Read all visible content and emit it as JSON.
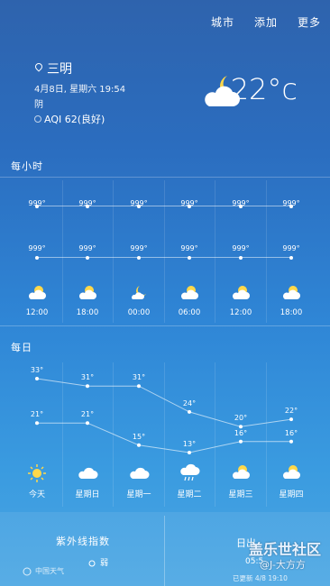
{
  "menu": {
    "city": "城市",
    "add": "添加",
    "more": "更多"
  },
  "current": {
    "city": "三明",
    "datetime": "4月8日, 星期六 19:54",
    "condition": "阴",
    "aqi": "AQI 62(良好)",
    "temperature": "22°c",
    "icon": "moon-cloud-icon"
  },
  "hourly": {
    "label": "每小时",
    "row1": [
      "999°",
      "999°",
      "999°",
      "999°",
      "999°",
      "999°"
    ],
    "row2": [
      "999°",
      "999°",
      "999°",
      "999°",
      "999°",
      "999°"
    ],
    "icons": [
      "sun-cloud-icon",
      "sun-cloud-icon",
      "moon-icon",
      "sun-cloud-icon",
      "sun-cloud-icon",
      "sun-cloud-icon"
    ],
    "times": [
      "12:00",
      "18:00",
      "00:00",
      "06:00",
      "12:00",
      "18:00"
    ]
  },
  "daily": {
    "label": "每日",
    "highs": [
      "33°",
      "31°",
      "31°",
      "24°",
      "20°",
      "22°"
    ],
    "lows": [
      "21°",
      "21°",
      "15°",
      "13°",
      "16°",
      "16°"
    ],
    "days": [
      "今天",
      "星期日",
      "星期一",
      "星期二",
      "星期三",
      "星期四"
    ],
    "icons": [
      "sun-icon",
      "cloud-icon",
      "cloud-icon",
      "rain-cloud-icon",
      "sun-cloud-icon",
      "sun-cloud-icon"
    ]
  },
  "uv": {
    "title": "紫外线指数",
    "value": "弱"
  },
  "sun": {
    "title": "日出",
    "sunrise": "05:5",
    "updated": "已更新 4/8 19:10"
  },
  "brand": "中国天气",
  "watermark": {
    "line1": "盖乐世社区",
    "line2": "@J-大方方"
  }
}
